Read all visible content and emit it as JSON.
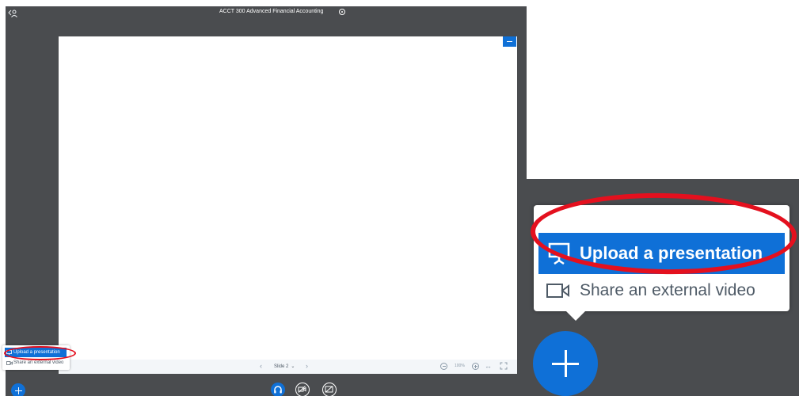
{
  "header": {
    "meeting_title": "ACCT 300 Advanced Financial Accounting"
  },
  "presentation_toolbar": {
    "prev_symbol": "‹",
    "slide_label": "Slide 2",
    "next_symbol": "›",
    "zoom_level": "100%",
    "fit_width_symbol": "↔"
  },
  "actions_menu": {
    "upload_label": "Upload a presentation",
    "external_video_label": "Share an external video"
  },
  "colors": {
    "primary": "#0f70d7",
    "panel_bg": "#4a4c4f",
    "highlight_ring": "#e4101e"
  },
  "icons": {
    "users": "users-icon",
    "recording": "recording-icon",
    "minimize": "minimize-icon",
    "plus": "plus-icon",
    "presentation": "presentation-icon",
    "video": "video-icon",
    "headphones": "headphones-icon",
    "webcam": "webcam-off-icon",
    "screenshare": "screenshare-off-icon"
  }
}
